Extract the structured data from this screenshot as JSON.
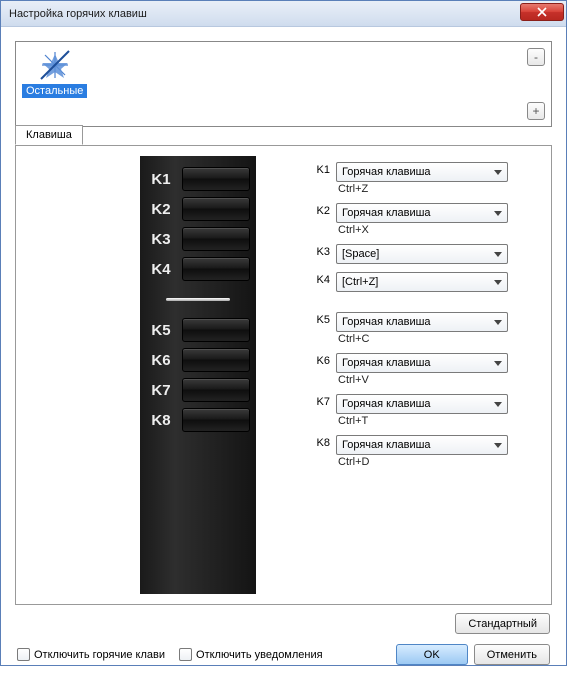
{
  "window": {
    "title": "Настройка горячих клавиш"
  },
  "category": {
    "label": "Остальные"
  },
  "side": {
    "minus": "-",
    "plus": "+"
  },
  "tab": {
    "label": "Клавиша"
  },
  "keypad_top": [
    "K1",
    "K2",
    "K3",
    "K4"
  ],
  "keypad_bottom": [
    "K5",
    "K6",
    "K7",
    "K8"
  ],
  "rows": [
    {
      "label": "K1",
      "value": "Горячая клавиша",
      "sub": "Ctrl+Z"
    },
    {
      "label": "K2",
      "value": "Горячая клавиша",
      "sub": "Ctrl+X"
    },
    {
      "label": "K3",
      "value": "[Space]",
      "sub": ""
    },
    {
      "label": "K4",
      "value": "[Ctrl+Z]",
      "sub": ""
    },
    {
      "label": "K5",
      "value": "Горячая клавиша",
      "sub": "Ctrl+C"
    },
    {
      "label": "K6",
      "value": "Горячая клавиша",
      "sub": "Ctrl+V"
    },
    {
      "label": "K7",
      "value": "Горячая клавиша",
      "sub": "Ctrl+T"
    },
    {
      "label": "K8",
      "value": "Горячая клавиша",
      "sub": "Ctrl+D"
    }
  ],
  "buttons": {
    "default": "Стандартный",
    "ok": "OK",
    "cancel": "Отменить"
  },
  "checkboxes": {
    "disable_hotkeys": "Отключить горячие клави",
    "disable_notifications": "Отключить уведомления"
  }
}
